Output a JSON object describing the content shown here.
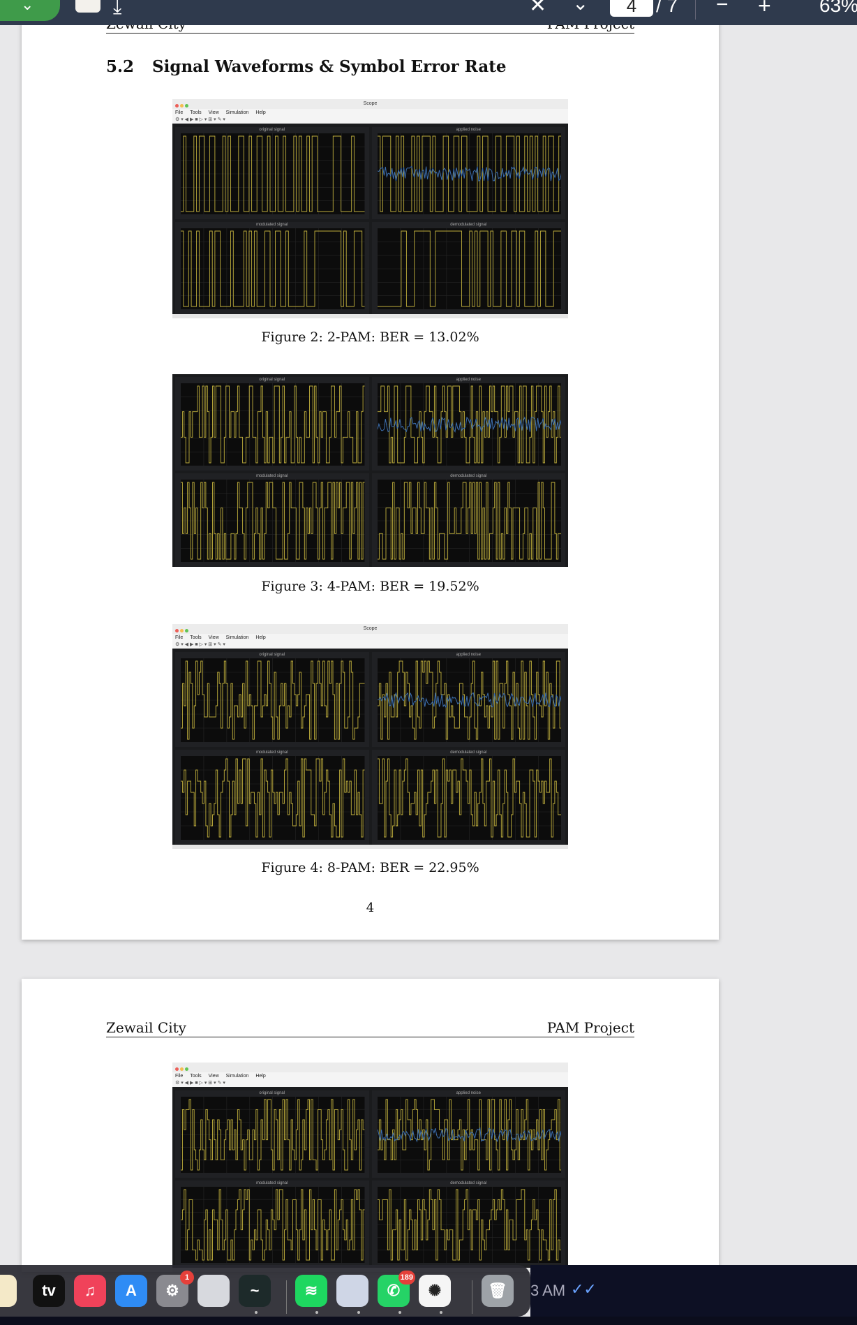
{
  "toolbar": {
    "page_current": "4",
    "page_total": "/ 7",
    "zoom": "63%",
    "icons": [
      "chevron-down-icon",
      "note-icon",
      "download-icon",
      "close-icon",
      "chevron-down-icon",
      "minus-icon",
      "plus-icon"
    ]
  },
  "page1": {
    "header_left": "Zewail City",
    "header_right": "PAM Project",
    "section_number": "5.2",
    "section_title": "Signal Waveforms & Symbol Error Rate",
    "figures": [
      {
        "caption": "Figure 2: 2-PAM: BER = 13.02%",
        "window_title": "Scope",
        "panels": [
          "original signal",
          "applied noise",
          "modulated signal",
          "demodulated signal"
        ],
        "levels": 2
      },
      {
        "caption": "Figure 3: 4-PAM: BER = 19.52%",
        "window_title": "",
        "panels": [
          "original signal",
          "applied noise",
          "modulated signal",
          "demodulated signal"
        ],
        "levels": 4
      },
      {
        "caption": "Figure 4: 8-PAM: BER = 22.95%",
        "window_title": "Scope",
        "panels": [
          "original signal",
          "applied noise",
          "modulated signal",
          "demodulated signal"
        ],
        "levels": 8
      }
    ],
    "page_number": "4"
  },
  "page2": {
    "header_left": "Zewail City",
    "header_right": "PAM Project",
    "figure_panels": [
      "original signal",
      "applied noise",
      "modulated signal",
      "demodulated signal"
    ]
  },
  "scope_menu": [
    "File",
    "Tools",
    "View",
    "Simulation",
    "Help"
  ],
  "dock": {
    "apps": [
      {
        "name": "notes",
        "color": "#f4e9c8",
        "label": ""
      },
      {
        "name": "apple-tv",
        "color": "#111111",
        "label": "tv"
      },
      {
        "name": "music",
        "color": "#f0425a",
        "label": "♫"
      },
      {
        "name": "app-store",
        "color": "#2f8cf5",
        "label": "A"
      },
      {
        "name": "system-settings",
        "color": "#8a8a90",
        "label": "⚙",
        "badge": "1"
      },
      {
        "name": "preview",
        "color": "#d7d9de",
        "label": ""
      },
      {
        "name": "activity-monitor",
        "color": "#1d2a2a",
        "label": "~"
      },
      {
        "name": "spotify",
        "color": "#1ed760",
        "label": "≋"
      },
      {
        "name": "photos-app",
        "color": "#cfd6e6",
        "label": ""
      },
      {
        "name": "whatsapp",
        "color": "#25d366",
        "label": "✆",
        "badge": "189"
      },
      {
        "name": "chatgpt",
        "color": "#f5f5f5",
        "label": "✺"
      },
      {
        "name": "trash",
        "color": "#9ea3a8",
        "label": "🗑"
      }
    ],
    "clock_partial": "3 AM"
  },
  "colors": {
    "trace": "#bfae3c",
    "noise": "#3c6fb0",
    "scope_bg": "#1a1b1d",
    "toolbar": "#2f3a4d"
  }
}
